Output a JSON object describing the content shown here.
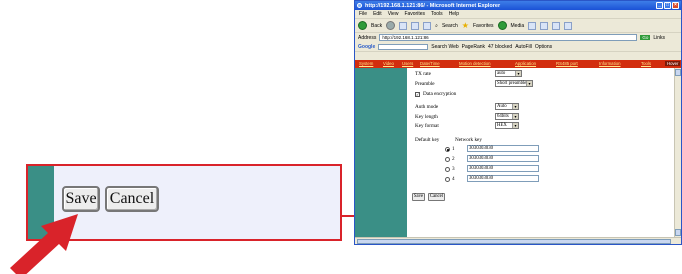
{
  "callout": {
    "save_label": "Save",
    "cancel_label": "Cancel"
  },
  "browser": {
    "title": "http://192.168.1.121:86/ - Microsoft Internet Explorer",
    "menu": [
      "File",
      "Edit",
      "View",
      "Favorites",
      "Tools",
      "Help"
    ],
    "toolbar": {
      "back": "Back",
      "search": "Search",
      "favorites": "Favorites",
      "media": "Media"
    },
    "address_label": "Address",
    "address_value": "http://192.168.1.121:86",
    "go_label": "Go",
    "links_label": "Links",
    "google_label": "Google",
    "google_search": "Search Web",
    "page_rank": "PageRank",
    "blocked": "47 blocked",
    "autofill": "AutoFill",
    "options": "Options"
  },
  "nav": [
    "System",
    "Video",
    "Users",
    "Date/Time",
    "Motion detection",
    "Application",
    "RS485 port",
    "Information",
    "Tools",
    "Hover"
  ],
  "form": {
    "tx_rate_label": "TX rate",
    "tx_rate_value": "auto",
    "preamble_label": "Preamble",
    "preamble_value": "Short preamble",
    "data_encryption_label": "Data encryption",
    "auth_mode_label": "Auth mode",
    "auth_mode_value": "Auto",
    "key_length_label": "Key length",
    "key_length_value": "64bits",
    "key_format_label": "Key format",
    "key_format_value": "HEX",
    "default_key_label": "Default key",
    "network_key_label": "Network key",
    "keys": [
      {
        "index": "1",
        "value": "3030303030"
      },
      {
        "index": "2",
        "value": "3030303030"
      },
      {
        "index": "3",
        "value": "3030303030"
      },
      {
        "index": "4",
        "value": "3030303030"
      }
    ],
    "save_label": "Save",
    "cancel_label": "Cancel"
  },
  "colors": {
    "accent_red": "#d9232a",
    "teal": "#3a8f86",
    "nav_red": "#d22d0e",
    "ie_blue": "#1b52d6"
  }
}
